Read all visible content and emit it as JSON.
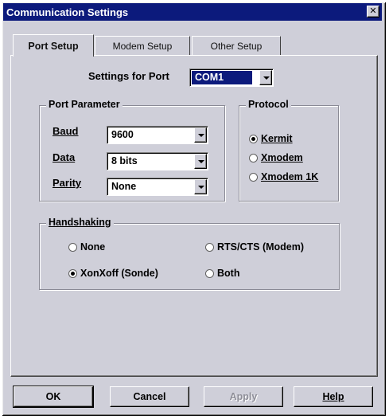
{
  "window": {
    "title": "Communication Settings",
    "close_glyph": "✕"
  },
  "tabs": [
    {
      "label": "Port Setup"
    },
    {
      "label": "Modem Setup"
    },
    {
      "label": "Other Setup"
    }
  ],
  "port": {
    "label": "Settings for Port",
    "value": "COM1"
  },
  "port_parameter": {
    "title": "Port Parameter",
    "baud": {
      "label": "Baud",
      "value": "9600"
    },
    "data": {
      "label": "Data",
      "value": "8 bits"
    },
    "parity": {
      "label": "Parity",
      "value": "None"
    }
  },
  "protocol": {
    "title": "Protocol",
    "options": [
      {
        "label": "Kermit",
        "selected": true
      },
      {
        "label": "Xmodem",
        "selected": false
      },
      {
        "label": "Xmodem 1K",
        "selected": false
      }
    ]
  },
  "handshaking": {
    "title": "Handshaking",
    "options": [
      {
        "label": "None",
        "selected": false
      },
      {
        "label": "RTS/CTS (Modem)",
        "selected": false
      },
      {
        "label": "XonXoff (Sonde)",
        "selected": true
      },
      {
        "label": "Both",
        "selected": false
      }
    ]
  },
  "buttons": {
    "ok": "OK",
    "cancel": "Cancel",
    "apply": "Apply",
    "help": "Help"
  }
}
